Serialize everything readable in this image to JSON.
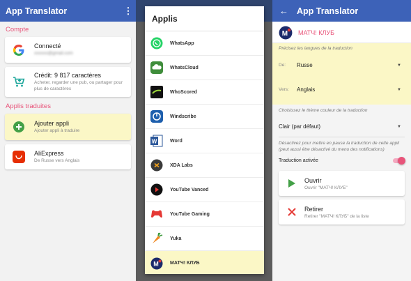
{
  "panel1": {
    "title": "App Translator",
    "account_section": "Compte",
    "account_status": "Connecté",
    "account_email": "xxxxxx@gmail.com",
    "credit_title": "Crédit: 9 817 caractères",
    "credit_hint": "Acheter, regarder une pub, ou partager pour plus de caractères",
    "apps_section": "Applis traduites",
    "add_app_title": "Ajouter appli",
    "add_app_sub": "Ajouter appli à traduire",
    "app_item_title": "AliExpress",
    "app_item_sub": "De Russe vers Anglais"
  },
  "panel2": {
    "dialog_title": "Applis",
    "apps": [
      {
        "name": "WhatsApp",
        "icon": "whatsapp-icon"
      },
      {
        "name": "WhatsCloud",
        "icon": "whatscloud-icon"
      },
      {
        "name": "WhoScored",
        "icon": "whoscored-icon"
      },
      {
        "name": "Windscribe",
        "icon": "windscribe-icon"
      },
      {
        "name": "Word",
        "icon": "word-icon"
      },
      {
        "name": "XDA Labs",
        "icon": "xda-labs-icon"
      },
      {
        "name": "YouTube Vanced",
        "icon": "youtube-vanced-icon"
      },
      {
        "name": "YouTube Gaming",
        "icon": "youtube-gaming-icon"
      },
      {
        "name": "Yuka",
        "icon": "yuka-icon"
      },
      {
        "name": "МАТЧ! КЛУБ",
        "icon": "match-club-icon"
      }
    ]
  },
  "panel3": {
    "title": "App Translator",
    "app_name": "МАТЧ! КЛУБ",
    "lang_hint": "Précisez les langues de la traduction",
    "from_label": "De:",
    "from_value": "Russe",
    "to_label": "Vers:",
    "to_value": "Anglais",
    "theme_hint": "Choisissez le thème couleur de la traduction",
    "theme_value": "Clair (par défaut)",
    "pause_hint": "Désactivez pour mettre en pause la traduction de cette appli (peut aussi être désactivé du menu des notifications)",
    "switch_label": "Traduction activée",
    "switch_on": true,
    "open_title": "Ouvrir",
    "open_sub": "Ouvrir \"МАТЧ! КЛУБ\"",
    "remove_title": "Retirer",
    "remove_sub": "Retirer \"МАТЧ! КЛУБ\" de la liste"
  },
  "colors": {
    "appbar": "#3d62b8",
    "accent_pink": "#e8547a",
    "highlight": "#fbf7c6",
    "green": "#43a047",
    "red": "#e53935"
  }
}
